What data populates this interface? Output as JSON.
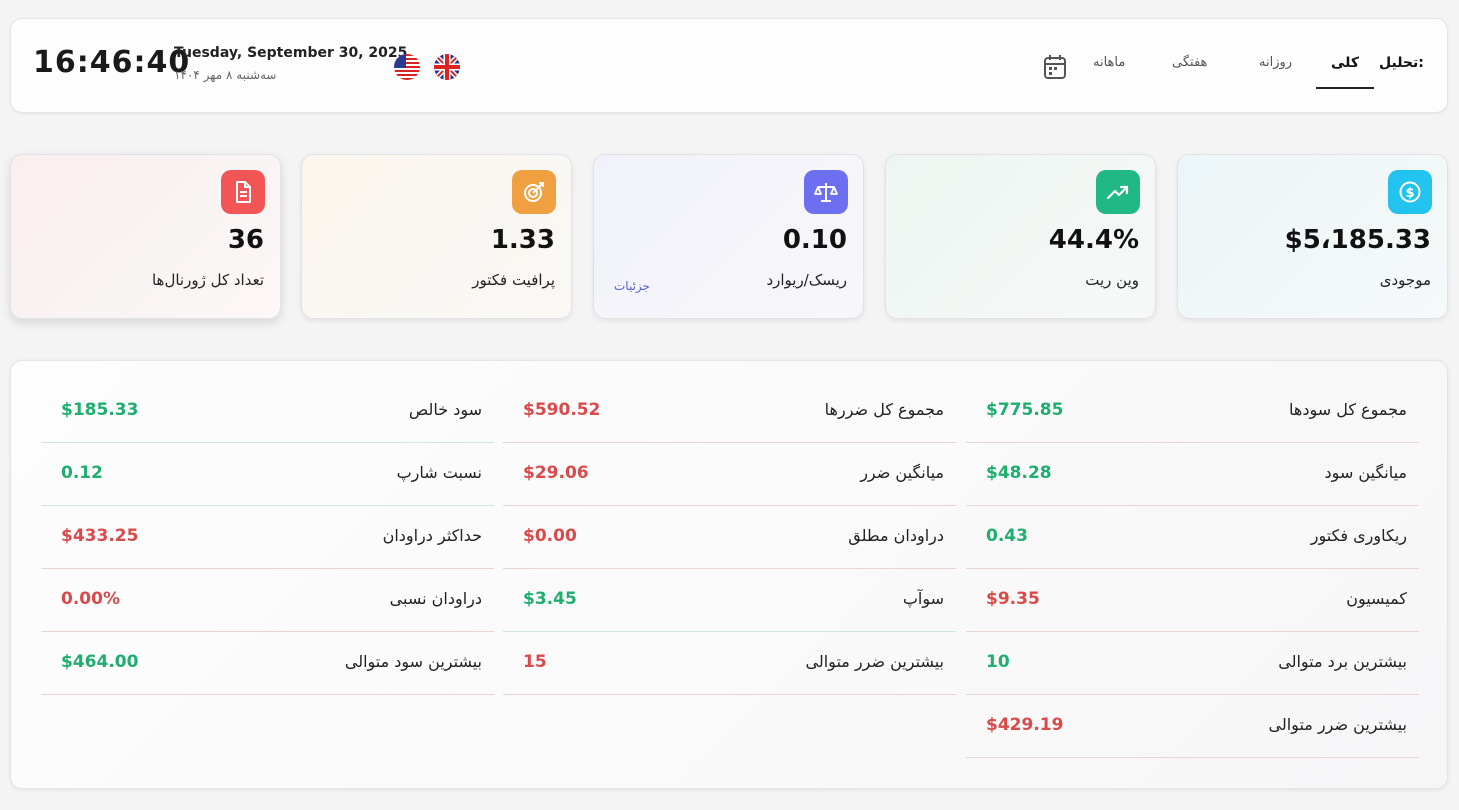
{
  "header": {
    "clock": "16:46:40",
    "date_en": "Tuesday, September 30, 2025",
    "date_fa": "سه‌شنبه ۸ مهر ۱۴۰۴",
    "analysis_label": "تحلیل:",
    "tabs": {
      "all": "کلی",
      "daily": "روزانه",
      "weekly": "هفتگی",
      "monthly": "ماهانه"
    },
    "active_tab": "all",
    "flags": [
      "us-flag-icon",
      "uk-flag-icon"
    ]
  },
  "cards": {
    "balance": {
      "value": "$5،185.33",
      "label": "موجودی",
      "icon": "dollar-coin-icon",
      "color": "#22c3ee"
    },
    "winrate": {
      "value": "44.4%",
      "label": "وین ریت",
      "icon": "trend-up-icon",
      "color": "#20b985"
    },
    "rr": {
      "value": "0.10",
      "label": "ریسک/ریوارد",
      "link": "جزئیات",
      "icon": "scale-icon",
      "color": "#6c6ff0"
    },
    "profit_factor": {
      "value": "1.33",
      "label": "پرافیت فکتور",
      "icon": "target-icon",
      "color": "#f0a040"
    },
    "journals": {
      "value": "36",
      "label": "تعداد کل ژورنال‌ها",
      "icon": "document-icon",
      "color": "#f25555"
    }
  },
  "details": {
    "col_right": [
      {
        "label": "مجموع کل سودها",
        "value": "$775.85",
        "tone": "pos"
      },
      {
        "label": "میانگین سود",
        "value": "$48.28",
        "tone": "pos"
      },
      {
        "label": "ریکاوری فکتور",
        "value": "0.43",
        "tone": "pos"
      },
      {
        "label": "کمیسیون",
        "value": "$9.35",
        "tone": "neg"
      },
      {
        "label": "بیشترین برد متوالی",
        "value": "10",
        "tone": "pos"
      },
      {
        "label": "بیشترین ضرر متوالی",
        "value": "$429.19",
        "tone": "neg"
      }
    ],
    "col_middle": [
      {
        "label": "مجموع کل ضررها",
        "value": "$590.52",
        "tone": "neg"
      },
      {
        "label": "میانگین ضرر",
        "value": "$29.06",
        "tone": "neg"
      },
      {
        "label": "دراودان مطلق",
        "value": "$0.00",
        "tone": "neg"
      },
      {
        "label": "سوآپ",
        "value": "$3.45",
        "tone": "pos"
      },
      {
        "label": "بیشترین ضرر متوالی",
        "value": "15",
        "tone": "neg"
      }
    ],
    "col_left": [
      {
        "label": "سود خالص",
        "value": "$185.33",
        "tone": "pos"
      },
      {
        "label": "نسبت شارپ",
        "value": "0.12",
        "tone": "pos"
      },
      {
        "label": "حداکثر دراودان",
        "value": "$433.25",
        "tone": "neg"
      },
      {
        "label": "دراودان نسبی",
        "value": "0.00%",
        "tone": "neg"
      },
      {
        "label": "بیشترین سود متوالی",
        "value": "$464.00",
        "tone": "pos"
      }
    ]
  }
}
